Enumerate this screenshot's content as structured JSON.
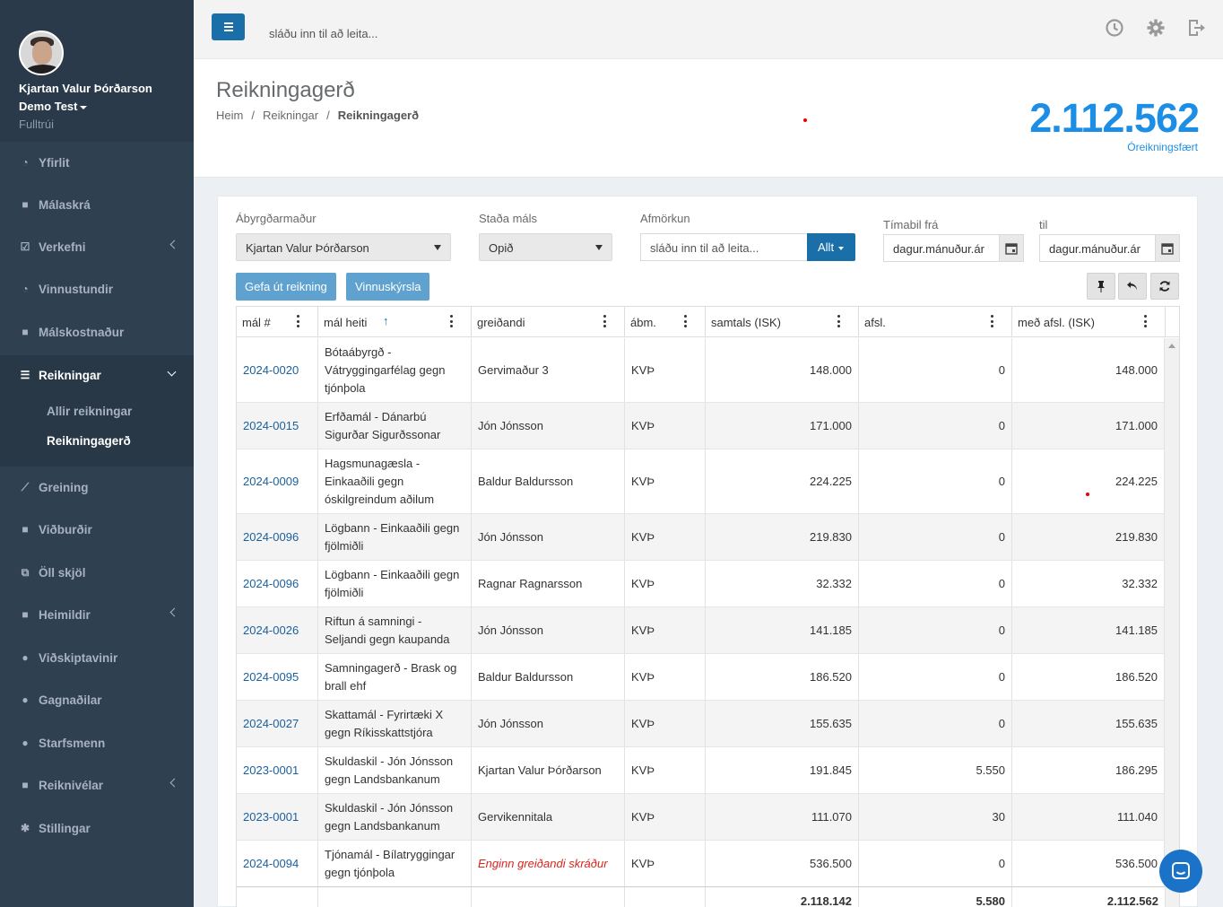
{
  "user": {
    "name": "Kjartan Valur Þórðarson",
    "company": "Demo Test",
    "role": "Fulltrúi"
  },
  "nav": [
    {
      "label": "Yfirlit",
      "icon": "gauge-icon"
    },
    {
      "label": "Málaskrá",
      "icon": "archive-icon"
    },
    {
      "label": "Verkefni",
      "icon": "checkbox-icon"
    },
    {
      "label": "Vinnustundir",
      "icon": "clock-icon"
    },
    {
      "label": "Málskostnaður",
      "icon": "table-icon"
    },
    {
      "label": "Reikningar",
      "icon": "list-icon"
    },
    {
      "label": "Greining",
      "icon": "chart-icon"
    },
    {
      "label": "Viðburðir",
      "icon": "calendar-icon"
    },
    {
      "label": "Öll skjöl",
      "icon": "files-icon"
    },
    {
      "label": "Heimildir",
      "icon": "book-icon"
    },
    {
      "label": "Viðskiptavinir",
      "icon": "user-icon"
    },
    {
      "label": "Gagnaðilar",
      "icon": "user-x-icon"
    },
    {
      "label": "Starfsmenn",
      "icon": "user-tie-icon"
    },
    {
      "label": "Reiknivélar",
      "icon": "calculator-icon"
    },
    {
      "label": "Stillingar",
      "icon": "gear-icon"
    }
  ],
  "subnav": [
    "Allir reikningar",
    "Reikningagerð"
  ],
  "topbar": {
    "search_placeholder": "sláðu inn til að leita..."
  },
  "page": {
    "title": "Reikningagerð",
    "breadcrumb": [
      "Heim",
      "Reikningar",
      "Reikningagerð"
    ],
    "total_value": "2.112.562",
    "total_label": "Óreikningsfært"
  },
  "filters": {
    "responsible_label": "Ábyrgðarmaður",
    "responsible_value": "Kjartan Valur Þórðarson",
    "status_label": "Staða máls",
    "status_value": "Opið",
    "filter_label": "Afmörkun",
    "filter_placeholder": "sláðu inn til að leita...",
    "filter_button": "Allt",
    "from_label": "Tímabil frá",
    "from_placeholder": "dagur.mánuður.ár",
    "to_label": "til",
    "to_placeholder": "dagur.mánuður.ár"
  },
  "buttons": {
    "issue_invoice": "Gefa út reikning",
    "work_report": "Vinnuskýrsla"
  },
  "table": {
    "columns": [
      "mál #",
      "mál heiti",
      "greiðandi",
      "ábm.",
      "samtals (ISK)",
      "afsl.",
      "með afsl. (ISK)"
    ],
    "rows": [
      {
        "case": "2024-0020",
        "name": "Bótaábyrgð - Vátryggingarfélag gegn tjónþola",
        "payer": "Gervimaður 3",
        "resp": "KVÞ",
        "total": "148.000",
        "discount": "0",
        "net": "148.000"
      },
      {
        "case": "2024-0015",
        "name": "Erfðamál - Dánarbú Sigurðar Sigurðssonar",
        "payer": "Jón Jónsson",
        "resp": "KVÞ",
        "total": "171.000",
        "discount": "0",
        "net": "171.000"
      },
      {
        "case": "2024-0009",
        "name": "Hagsmunagæsla - Einkaaðili gegn óskilgreindum aðilum",
        "payer": "Baldur Baldursson",
        "resp": "KVÞ",
        "total": "224.225",
        "discount": "0",
        "net": "224.225"
      },
      {
        "case": "2024-0096",
        "name": "Lögbann - Einkaaðili gegn fjölmiðli",
        "payer": "Jón Jónsson",
        "resp": "KVÞ",
        "total": "219.830",
        "discount": "0",
        "net": "219.830"
      },
      {
        "case": "2024-0096",
        "name": "Lögbann - Einkaaðili gegn fjölmiðli",
        "payer": "Ragnar Ragnarsson",
        "resp": "KVÞ",
        "total": "32.332",
        "discount": "0",
        "net": "32.332"
      },
      {
        "case": "2024-0026",
        "name": "Riftun á samningi - Seljandi gegn kaupanda",
        "payer": "Jón Jónsson",
        "resp": "KVÞ",
        "total": "141.185",
        "discount": "0",
        "net": "141.185"
      },
      {
        "case": "2024-0095",
        "name": "Samningagerð - Brask og brall ehf",
        "payer": "Baldur Baldursson",
        "resp": "KVÞ",
        "total": "186.520",
        "discount": "0",
        "net": "186.520"
      },
      {
        "case": "2024-0027",
        "name": "Skattamál - Fyrirtæki X gegn Ríkisskattstjóra",
        "payer": "Jón Jónsson",
        "resp": "KVÞ",
        "total": "155.635",
        "discount": "0",
        "net": "155.635"
      },
      {
        "case": "2023-0001",
        "name": "Skuldaskil - Jón Jónsson gegn Landsbankanum",
        "payer": "Kjartan Valur Þórðarson",
        "resp": "KVÞ",
        "total": "191.845",
        "discount": "5.550",
        "net": "186.295"
      },
      {
        "case": "2023-0001",
        "name": "Skuldaskil - Jón Jónsson gegn Landsbankanum",
        "payer": "Gervikennitala",
        "resp": "KVÞ",
        "total": "111.070",
        "discount": "30",
        "net": "111.040"
      },
      {
        "case": "2024-0094",
        "name": "Tjónamál - Bílatryggingar gegn tjónþola",
        "payer": "Enginn greiðandi skráður",
        "resp": "KVÞ",
        "total": "536.500",
        "discount": "0",
        "net": "536.500",
        "payer_missing": true
      }
    ],
    "totals": {
      "total": "2.118.142",
      "discount": "5.580",
      "net": "2.112.562"
    }
  },
  "colors": {
    "sidebar": "#2f4050",
    "primary": "#1a6fa8",
    "accent": "#1c8ee6",
    "missing_payer": "#d9261c"
  }
}
